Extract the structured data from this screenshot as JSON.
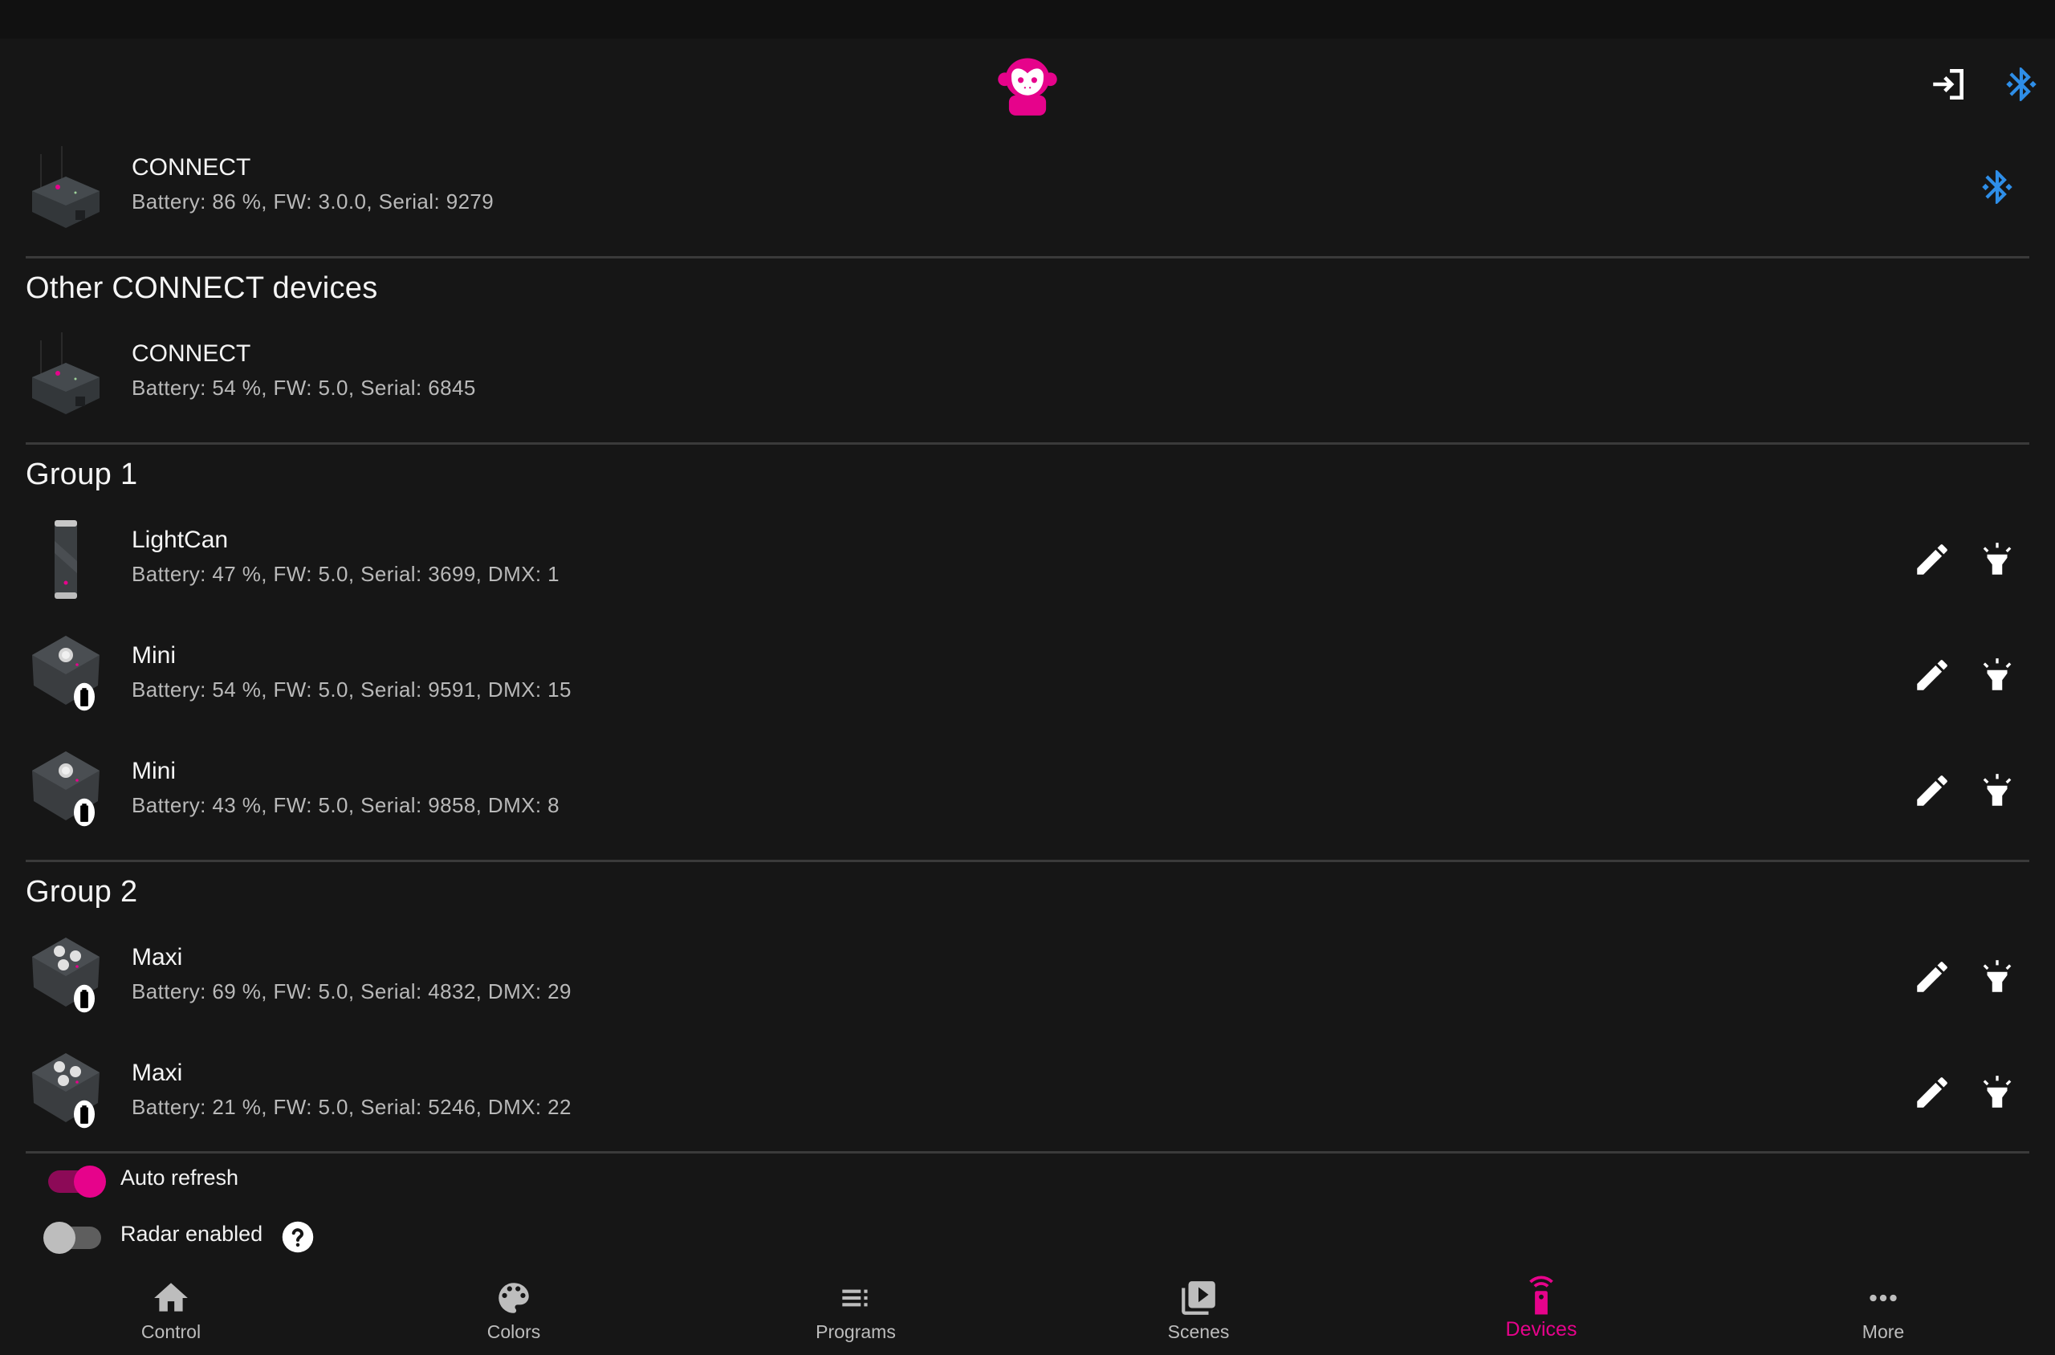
{
  "colors": {
    "accent": "#e6038b",
    "bluetooth": "#2e8ee8",
    "background": "#161616",
    "separator": "#3a3a3a"
  },
  "header": {
    "logo": "monkey-logo",
    "actions": [
      {
        "icon": "login-icon",
        "label": "Log in"
      },
      {
        "icon": "bluetooth-searching-icon",
        "label": "Bluetooth"
      }
    ]
  },
  "connected_device": {
    "name": "CONNECT",
    "details": "Battery: 86 %,  FW: 3.0.0,  Serial: 9279",
    "battery": 86,
    "fw": "3.0.0",
    "serial": "9279",
    "status_icon": "bluetooth-searching-icon"
  },
  "other_connect": {
    "title": "Other CONNECT devices",
    "devices": [
      {
        "name": "CONNECT",
        "details": "Battery: 54 %,  FW: 5.0,  Serial: 6845"
      }
    ]
  },
  "groups": [
    {
      "title": "Group 1",
      "devices": [
        {
          "name": "LightCan",
          "details": "Battery: 47 %,  FW: 5.0,  Serial: 3699,  DMX: 1",
          "type": "lightcan"
        },
        {
          "name": "Mini",
          "details": "Battery: 54 %,  FW: 5.0,  Serial: 9591,  DMX: 15",
          "type": "mini"
        },
        {
          "name": "Mini",
          "details": "Battery: 43 %,  FW: 5.0,  Serial: 9858,  DMX: 8",
          "type": "mini"
        }
      ]
    },
    {
      "title": "Group 2",
      "devices": [
        {
          "name": "Maxi",
          "details": "Battery: 69 %,  FW: 5.0,  Serial: 4832,  DMX: 29",
          "type": "maxi"
        },
        {
          "name": "Maxi",
          "details": "Battery: 21 %,  FW: 5.0,  Serial: 5246,  DMX: 22",
          "type": "maxi"
        }
      ]
    }
  ],
  "settings": {
    "auto_refresh": {
      "label": "Auto refresh",
      "on": true
    },
    "radar": {
      "label": "Radar enabled",
      "on": false,
      "help_icon": "help-icon"
    }
  },
  "nav": [
    {
      "label": "Control",
      "icon": "home-icon",
      "active": false
    },
    {
      "label": "Colors",
      "icon": "palette-icon",
      "active": false
    },
    {
      "label": "Programs",
      "icon": "playlist-icon",
      "active": false
    },
    {
      "label": "Scenes",
      "icon": "video-library-icon",
      "active": false
    },
    {
      "label": "Devices",
      "icon": "remote-icon",
      "active": true
    },
    {
      "label": "More",
      "icon": "more-horizontal-icon",
      "active": false
    }
  ]
}
